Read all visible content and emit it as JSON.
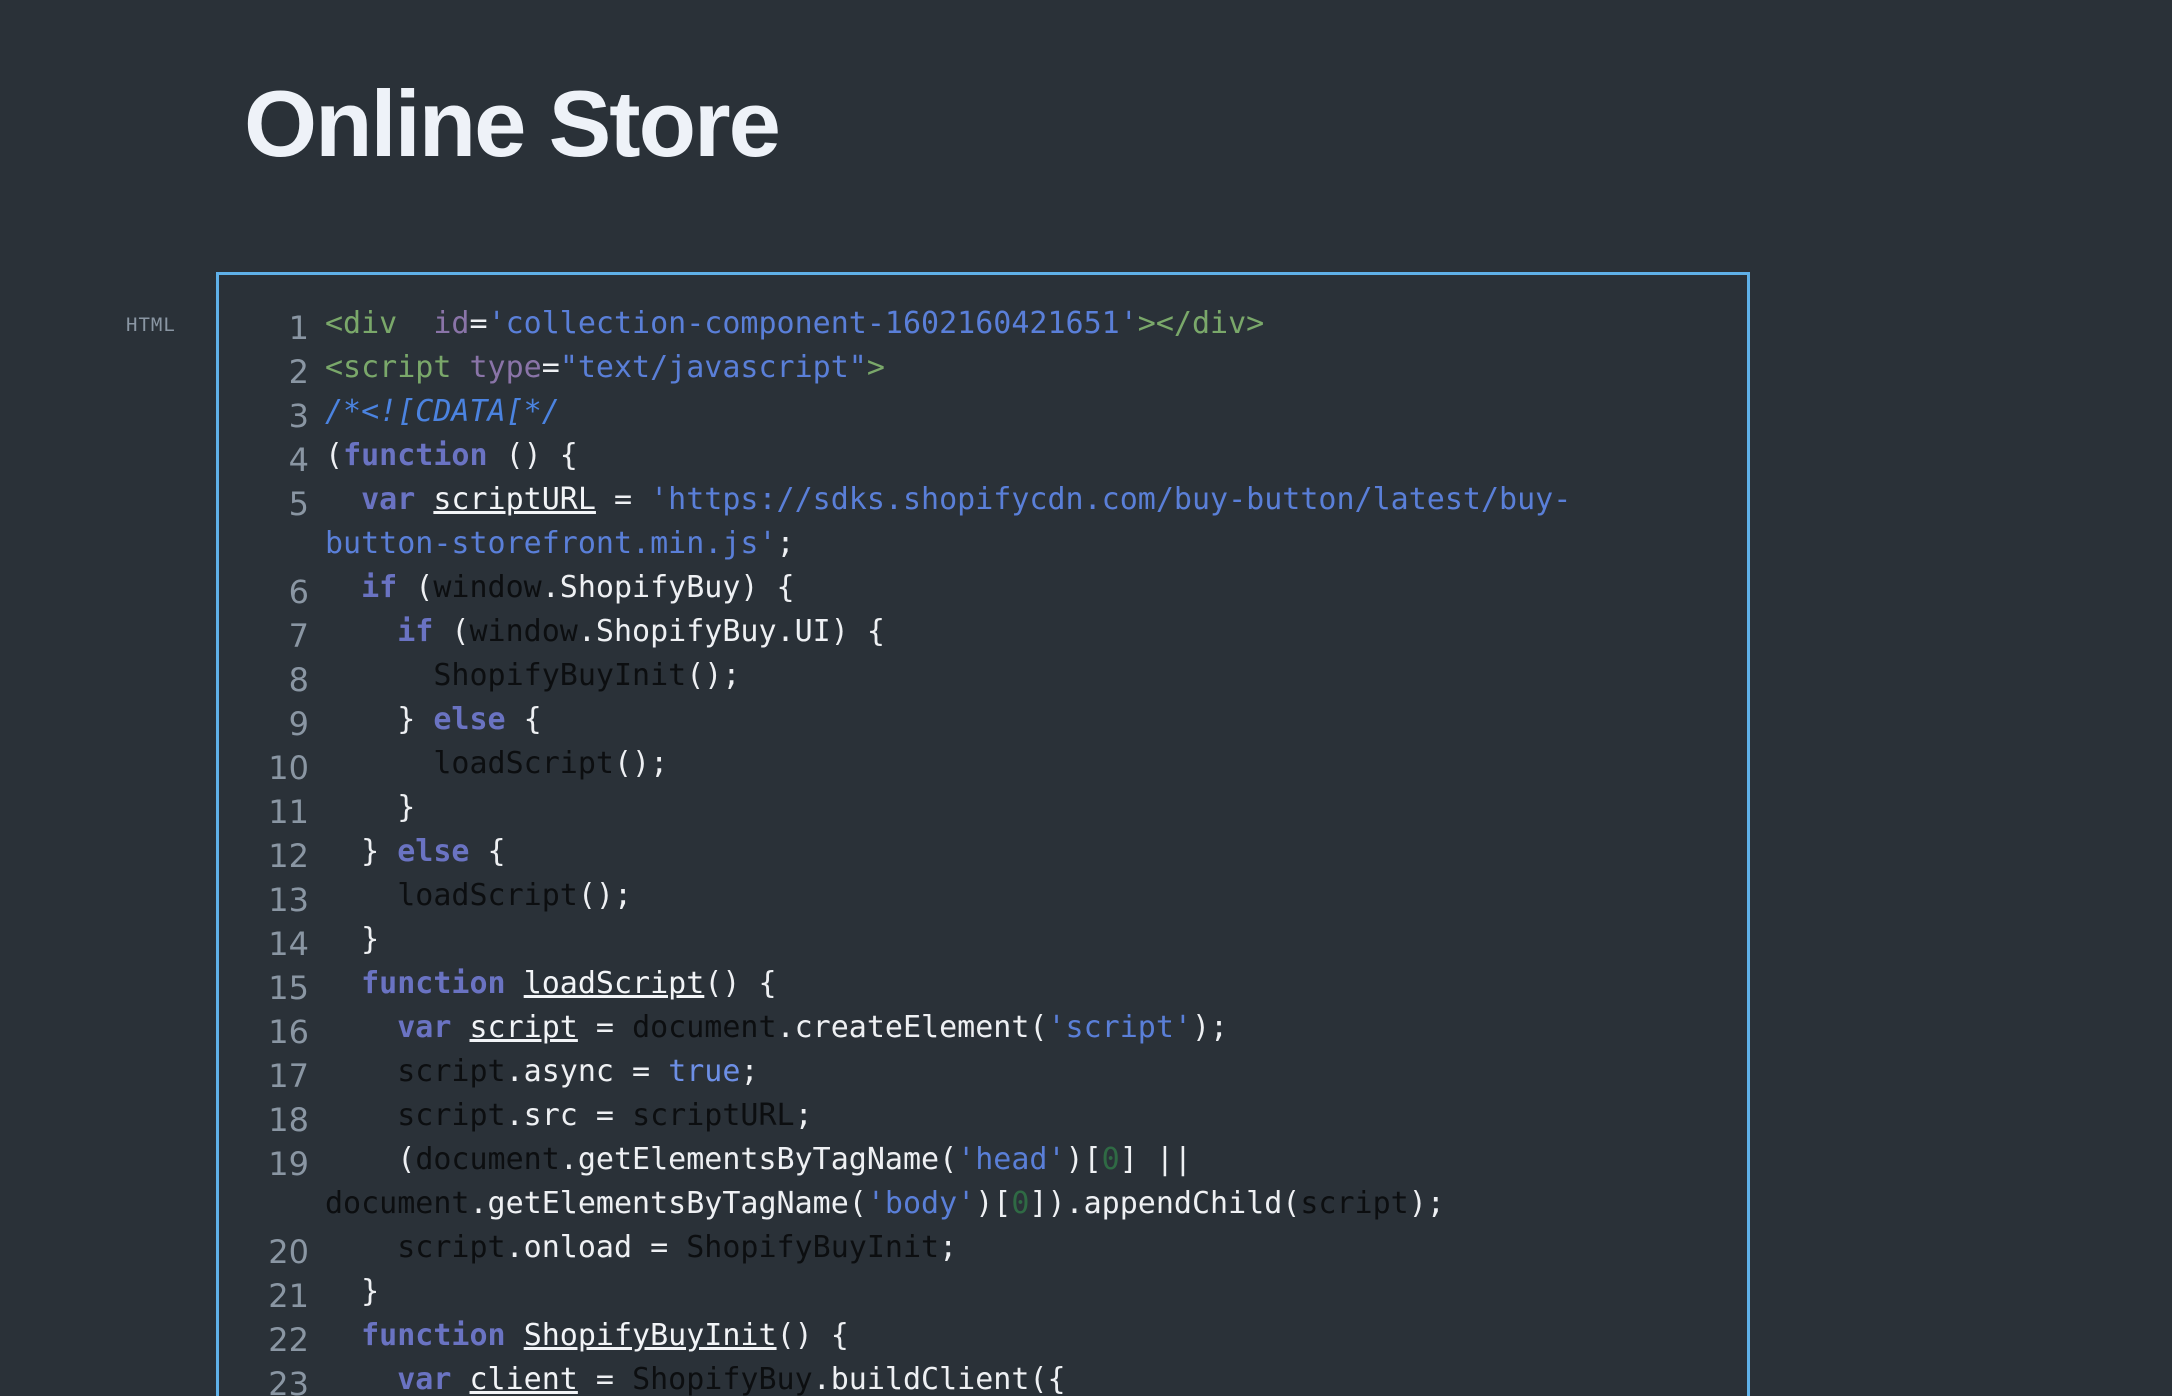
{
  "page": {
    "title": "Online Store"
  },
  "code_block": {
    "language_label": "HTML",
    "colors": {
      "background": "#2a3138",
      "frame_border": "#5fb0e8",
      "tag": "#7aa86a",
      "attribute": "#8a74a8",
      "string": "#5a7fd8",
      "keyword": "#6a73c2",
      "identifier_dark": "#0c0e10",
      "number": "#2f6a44",
      "line_number": "#8a96a3"
    },
    "lines": [
      {
        "n": "1",
        "t": [
          "<div ",
          " id",
          "=",
          "'collection-component-1602160421651'",
          "></div>"
        ]
      },
      {
        "n": "2",
        "t": [
          "<script ",
          "type",
          "=",
          "\"text/javascript\"",
          ">"
        ]
      },
      {
        "n": "3",
        "t": [
          "/*<![CDATA[*/"
        ]
      },
      {
        "n": "4",
        "t": [
          "(",
          "function",
          " () {"
        ]
      },
      {
        "n": "5",
        "t": [
          "  ",
          "var",
          " ",
          "scriptURL",
          " = ",
          "'https://sdks.shopifycdn.com/buy-button/latest/buy-",
          "button-storefront.min.js'",
          ";"
        ]
      },
      {
        "n": "6",
        "t": [
          "  ",
          "if",
          " (",
          "window",
          ".ShopifyBuy) {"
        ]
      },
      {
        "n": "7",
        "t": [
          "    ",
          "if",
          " (",
          "window",
          ".ShopifyBuy.UI) {"
        ]
      },
      {
        "n": "8",
        "t": [
          "      ",
          "ShopifyBuyInit",
          "();"
        ]
      },
      {
        "n": "9",
        "t": [
          "    } ",
          "else",
          " {"
        ]
      },
      {
        "n": "10",
        "t": [
          "      ",
          "loadScript",
          "();"
        ]
      },
      {
        "n": "11",
        "t": [
          "    }"
        ]
      },
      {
        "n": "12",
        "t": [
          "  } ",
          "else",
          " {"
        ]
      },
      {
        "n": "13",
        "t": [
          "    ",
          "loadScript",
          "();"
        ]
      },
      {
        "n": "14",
        "t": [
          "  }"
        ]
      },
      {
        "n": "15",
        "t": [
          "  ",
          "function",
          " ",
          "loadScript",
          "() {"
        ]
      },
      {
        "n": "16",
        "t": [
          "    ",
          "var",
          " ",
          "script",
          " = ",
          "document",
          ".createElement(",
          "'script'",
          ");"
        ]
      },
      {
        "n": "17",
        "t": [
          "    ",
          "script",
          ".async = ",
          "true",
          ";"
        ]
      },
      {
        "n": "18",
        "t": [
          "    ",
          "script",
          ".src = ",
          "scriptURL",
          ";"
        ]
      },
      {
        "n": "19",
        "t": [
          "    (",
          "document",
          ".getElementsByTagName(",
          "'head'",
          ")[",
          "0",
          "] ||",
          "document",
          ".getElementsByTagName(",
          "'body'",
          ")[",
          "0",
          "]).appendChild(",
          "script",
          ");"
        ]
      },
      {
        "n": "20",
        "t": [
          "    ",
          "script",
          ".onload = ",
          "ShopifyBuyInit",
          ";"
        ]
      },
      {
        "n": "21",
        "t": [
          "  }"
        ]
      },
      {
        "n": "22",
        "t": [
          "  ",
          "function",
          " ",
          "ShopifyBuyInit",
          "() {"
        ]
      },
      {
        "n": "23",
        "t": [
          "    ",
          "var",
          " ",
          "client",
          " = ",
          "ShopifyBuy",
          ".buildClient({"
        ]
      }
    ]
  }
}
